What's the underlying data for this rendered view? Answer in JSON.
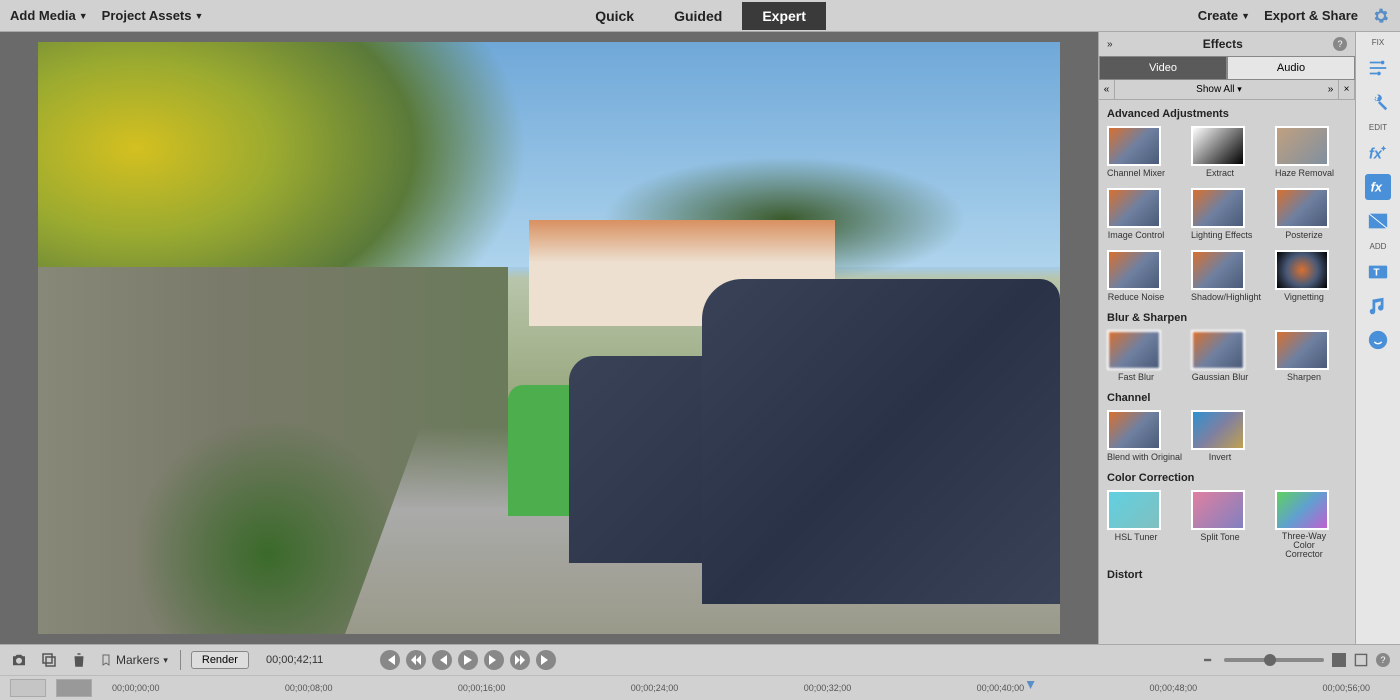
{
  "topbar": {
    "left": [
      {
        "label": "Add Media"
      },
      {
        "label": "Project Assets"
      }
    ],
    "tabs": [
      {
        "label": "Quick",
        "active": false
      },
      {
        "label": "Guided",
        "active": false
      },
      {
        "label": "Expert",
        "active": true
      }
    ],
    "right": [
      {
        "label": "Create"
      },
      {
        "label": "Export & Share"
      }
    ]
  },
  "effects": {
    "panel_title": "Effects",
    "tabs": {
      "video": "Video",
      "audio": "Audio"
    },
    "filter": "Show All",
    "categories": [
      {
        "name": "Advanced Adjustments",
        "items": [
          "Channel Mixer",
          "Extract",
          "Haze Removal",
          "Image Control",
          "Lighting Effects",
          "Posterize",
          "Reduce Noise",
          "Shadow/Highlight",
          "Vignetting"
        ]
      },
      {
        "name": "Blur & Sharpen",
        "items": [
          "Fast Blur",
          "Gaussian Blur",
          "Sharpen"
        ]
      },
      {
        "name": "Channel",
        "items": [
          "Blend with Original",
          "Invert"
        ]
      },
      {
        "name": "Color Correction",
        "items": [
          "HSL Tuner",
          "Split Tone",
          "Three-Way Color Corrector"
        ]
      },
      {
        "name": "Distort",
        "items": []
      }
    ]
  },
  "tools_rail": {
    "fix": "FIX",
    "edit": "EDIT",
    "add": "ADD"
  },
  "transport": {
    "markers": "Markers",
    "render": "Render",
    "timecode": "00;00;42;11"
  },
  "ruler": {
    "ticks": [
      "00;00;00;00",
      "00;00;08;00",
      "00;00;16;00",
      "00;00;24;00",
      "00;00;32;00",
      "00;00;40;00",
      "00;00;48;00",
      "00;00;56;00"
    ]
  }
}
